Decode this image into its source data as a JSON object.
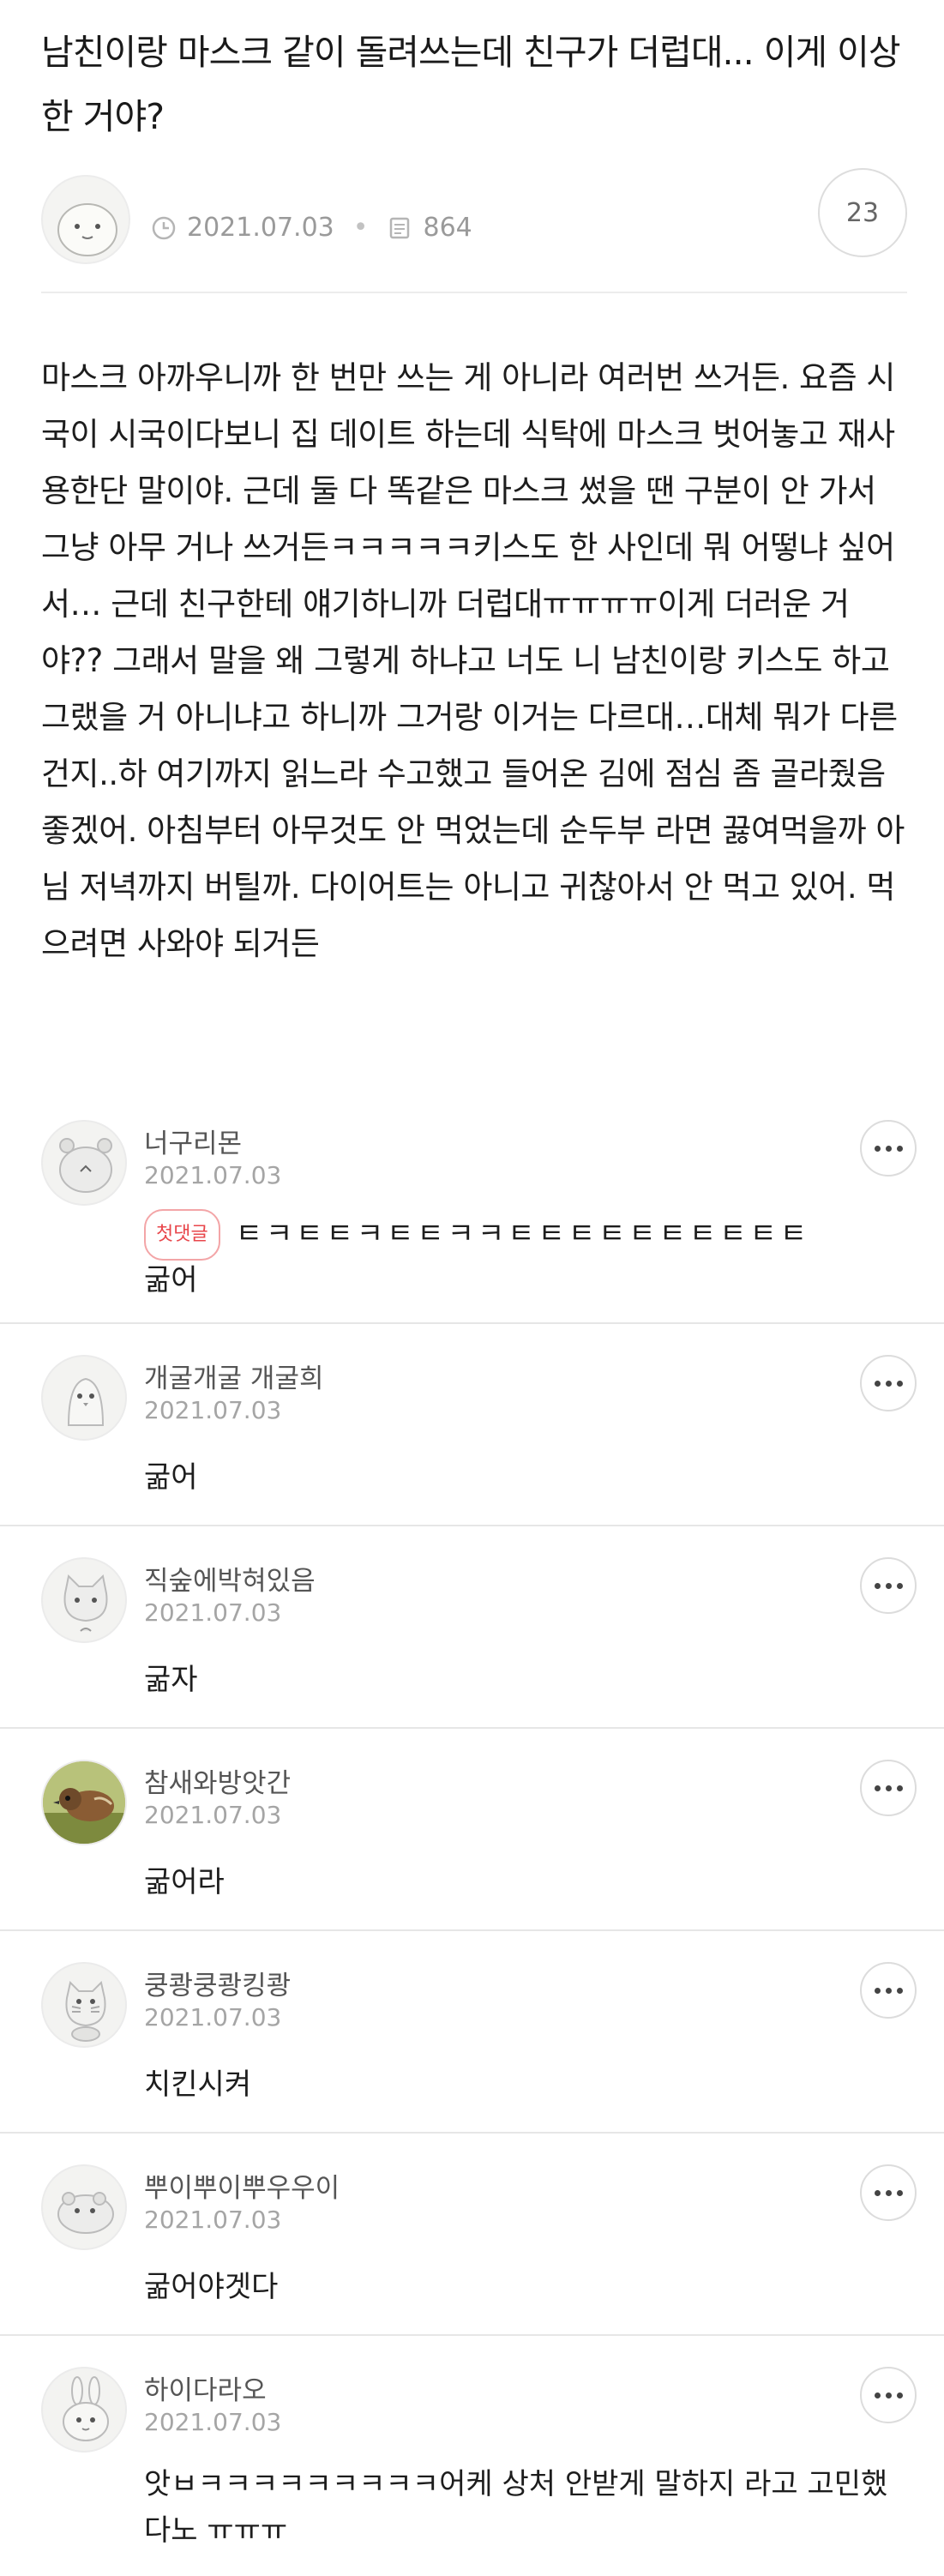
{
  "post": {
    "title": "남친이랑 마스크 같이 돌려쓰는데 친구가 더럽대... 이게 이상한 거야?",
    "date": "2021.07.03",
    "views": "864",
    "comment_count": "23",
    "body": "마스크 아까우니까 한 번만 쓰는 게 아니라 여러번 쓰거든. 요즘 시국이 시국이다보니 집 데이트 하는데 식탁에 마스크 벗어놓고 재사용한단 말이야. 근데 둘 다 똑같은 마스크 썼을 땐 구분이 안 가서 그냥 아무 거나 쓰거든ㅋㅋㅋㅋㅋ키스도 한 사인데 뭐 어떻냐 싶어서… 근데 친구한테 얘기하니까 더럽대ㅠㅠㅠㅠ이게 더러운 거야?? 그래서 말을 왜 그렇게 하냐고 너도 니 남친이랑 키스도 하고 그랬을 거 아니냐고 하니까 그거랑 이거는 다르대…대체 뭐가 다른 건지..하 여기까지 읽느라 수고했고 들어온 김에 점심 좀 골라줬음 좋겠어. 아침부터 아무것도 안 먹었는데 순두부 라면 끓여먹을까 아님 저녁까지 버틸까. 다이어트는 아니고 귀찮아서 안 먹고 있어. 먹으려면 사와야 되거든"
  },
  "comments": [
    {
      "name": "너구리몬",
      "date": "2021.07.03",
      "badge": "첫댓글",
      "first_line": "ㅌㅋㅌㅌㅋㅌㅌㅋㅋㅌㅌㅌㅌㅌㅌㅌㅌㅌㅌ",
      "text": "굶어",
      "avatar": "raccoon-avatar"
    },
    {
      "name": "개굴개굴 개굴희",
      "date": "2021.07.03",
      "text": "굶어",
      "avatar": "bird-avatar"
    },
    {
      "name": "직숲에박혀있음",
      "date": "2021.07.03",
      "text": "굶자",
      "avatar": "cat-avatar"
    },
    {
      "name": "참새와방앗간",
      "date": "2021.07.03",
      "text": "굶어라",
      "avatar": "sparrow-photo-avatar"
    },
    {
      "name": "쿵쾅쿵쾅킹쾅",
      "date": "2021.07.03",
      "text": "치킨시켜",
      "avatar": "squirrel-avatar"
    },
    {
      "name": "뿌이뿌이뿌우우이",
      "date": "2021.07.03",
      "text": "굶어야겟다",
      "avatar": "hamster-avatar"
    },
    {
      "name": "하이다라오",
      "date": "2021.07.03",
      "text": "앗ㅂㅋㅋㅋㅋㅋㅋㅋㅋㅋ어케 상처 안받게 말하지 라고 고민했다노 ㅠㅠㅠ",
      "avatar": "rabbit-avatar"
    }
  ]
}
